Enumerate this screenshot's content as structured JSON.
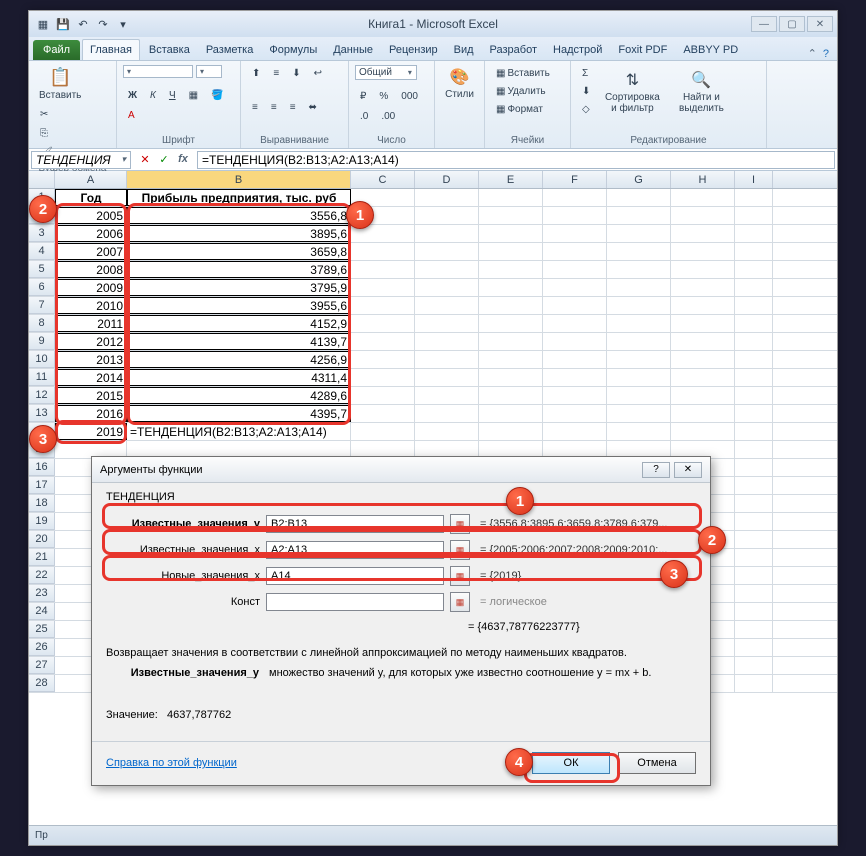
{
  "window": {
    "title": "Книга1 - Microsoft Excel"
  },
  "tabs": {
    "file": "Файл",
    "items": [
      "Главная",
      "Вставка",
      "Разметка",
      "Формулы",
      "Данные",
      "Рецензир",
      "Вид",
      "Разработ",
      "Надстрой",
      "Foxit PDF",
      "ABBYY PD"
    ],
    "active": 0
  },
  "ribbon": {
    "clipboard": {
      "paste": "Вставить",
      "label": "Буфер обмена"
    },
    "font": {
      "bold": "Ж",
      "italic": "К",
      "underline": "Ч",
      "label": "Шрифт"
    },
    "alignment": {
      "label": "Выравнивание"
    },
    "number": {
      "format": "Общий",
      "label": "Число"
    },
    "styles": {
      "btn": "Стили",
      "label": ""
    },
    "cells": {
      "insert": "Вставить",
      "delete": "Удалить",
      "format": "Формат",
      "label": "Ячейки"
    },
    "editing": {
      "sigma": "Σ",
      "sort": "Сортировка и фильтр",
      "find": "Найти и выделить",
      "label": "Редактирование"
    }
  },
  "fbar": {
    "name": "ТЕНДЕНЦИЯ",
    "formula": "=ТЕНДЕНЦИЯ(B2:B13;A2:A13;A14)"
  },
  "cols": [
    "A",
    "B",
    "C",
    "D",
    "E",
    "F",
    "G",
    "H",
    "I"
  ],
  "headers": {
    "A": "Год",
    "B": "Прибыль предприятия, тыс. руб"
  },
  "data": [
    {
      "r": 2,
      "A": "2005",
      "B": "3556,8"
    },
    {
      "r": 3,
      "A": "2006",
      "B": "3895,6"
    },
    {
      "r": 4,
      "A": "2007",
      "B": "3659,8"
    },
    {
      "r": 5,
      "A": "2008",
      "B": "3789,6"
    },
    {
      "r": 6,
      "A": "2009",
      "B": "3795,9"
    },
    {
      "r": 7,
      "A": "2010",
      "B": "3955,6"
    },
    {
      "r": 8,
      "A": "2011",
      "B": "4152,9"
    },
    {
      "r": 9,
      "A": "2012",
      "B": "4139,7"
    },
    {
      "r": 10,
      "A": "2013",
      "B": "4256,9"
    },
    {
      "r": 11,
      "A": "2014",
      "B": "4311,4"
    },
    {
      "r": 12,
      "A": "2015",
      "B": "4289,6"
    },
    {
      "r": 13,
      "A": "2016",
      "B": "4395,7"
    }
  ],
  "row14": {
    "A": "2019",
    "B": "=ТЕНДЕНЦИЯ(B2:B13;A2:A13;A14)"
  },
  "dialog": {
    "title": "Аргументы функции",
    "fname": "ТЕНДЕНЦИЯ",
    "args": [
      {
        "label": "Известные_значения_y",
        "value": "B2:B13",
        "preview": "= {3556,8:3895,6:3659,8:3789,6:379..."
      },
      {
        "label": "Известные_значения_x",
        "value": "A2:A13",
        "preview": "= {2005:2006:2007:2008:2009:2010:..."
      },
      {
        "label": "Новые_значения_x",
        "value": "A14",
        "preview": "= {2019}"
      },
      {
        "label": "Конст",
        "value": "",
        "preview": "= логическое"
      }
    ],
    "result_inline": "= {4637,78776223777}",
    "desc": "Возвращает значения в соответствии с линейной аппроксимацией по методу наименьших квадратов.",
    "argdesc_label": "Известные_значения_y",
    "argdesc_text": "множество значений y, для которых уже известно соотношение y = mx + b.",
    "result_label": "Значение:",
    "result_value": "4637,787762",
    "help": "Справка по этой функции",
    "ok": "ОК",
    "cancel": "Отмена"
  },
  "status": "Пр"
}
